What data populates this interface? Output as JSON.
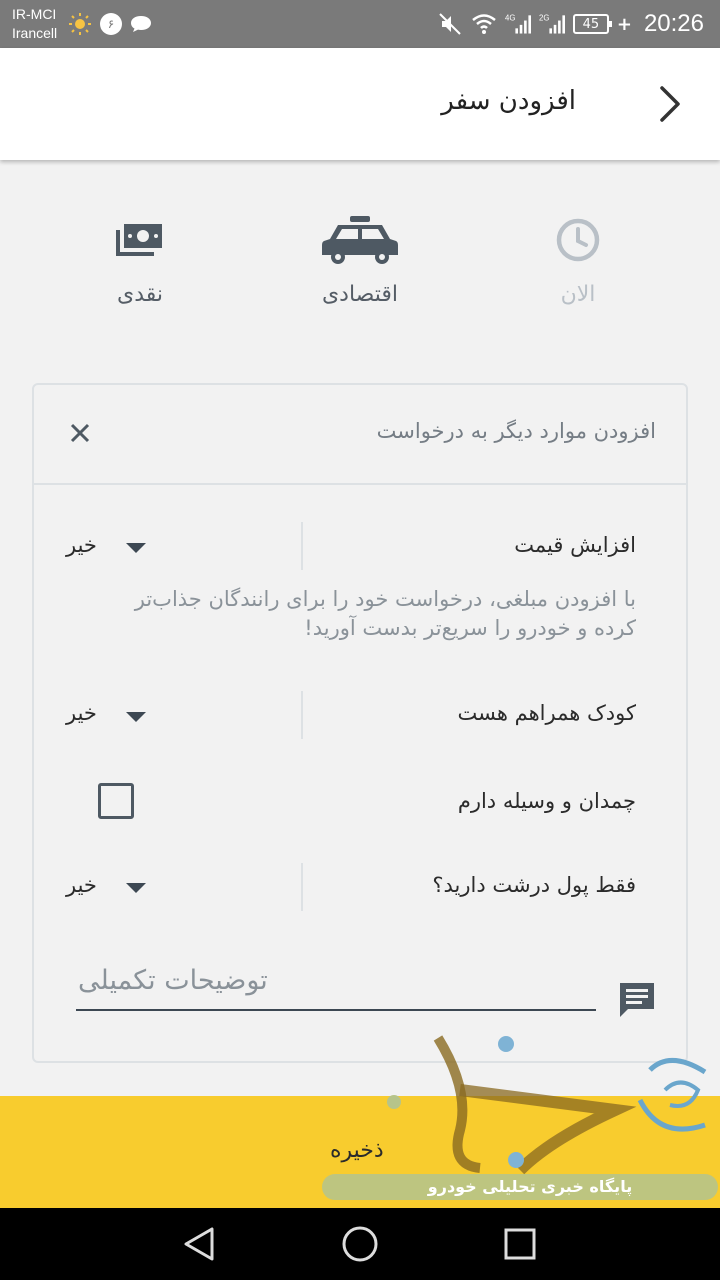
{
  "status_bar": {
    "carrier_line1": "IR-MCI",
    "carrier_line2": "Irancell",
    "notification_count": "۶",
    "net1": "4G",
    "net2": "2G",
    "battery": "45",
    "time": "20:26"
  },
  "app_bar": {
    "title": "افزودن سفر"
  },
  "options": [
    {
      "label": "الان",
      "icon": "clock-icon"
    },
    {
      "label": "اقتصادی",
      "icon": "taxi-icon"
    },
    {
      "label": "نقدی",
      "icon": "cash-icon"
    }
  ],
  "card": {
    "title": "افزودن موارد دیگر به درخواست",
    "price_increase": {
      "label": "افزایش قیمت",
      "value": "خیر"
    },
    "helper_text": "با افزودن مبلغی، درخواست خود را برای رانندگان جذاب‌تر کرده و خودرو را سریع‌تر بدست آورید!",
    "child": {
      "label": "کودک همراهم هست",
      "value": "خیر"
    },
    "luggage": {
      "label": "چمدان و وسیله دارم",
      "checked": false
    },
    "large_bills": {
      "label": "فقط پول درشت دارید؟",
      "value": "خیر"
    },
    "notes_placeholder": "توضیحات تکمیلی"
  },
  "save_button": {
    "label": "ذخیره"
  },
  "watermark": {
    "text": "پایگاه خبری تحلیلی خودرو"
  },
  "colors": {
    "accent": "#f8cc2e",
    "icon_dark": "#4e5963",
    "icon_muted": "#b9c0c7"
  }
}
